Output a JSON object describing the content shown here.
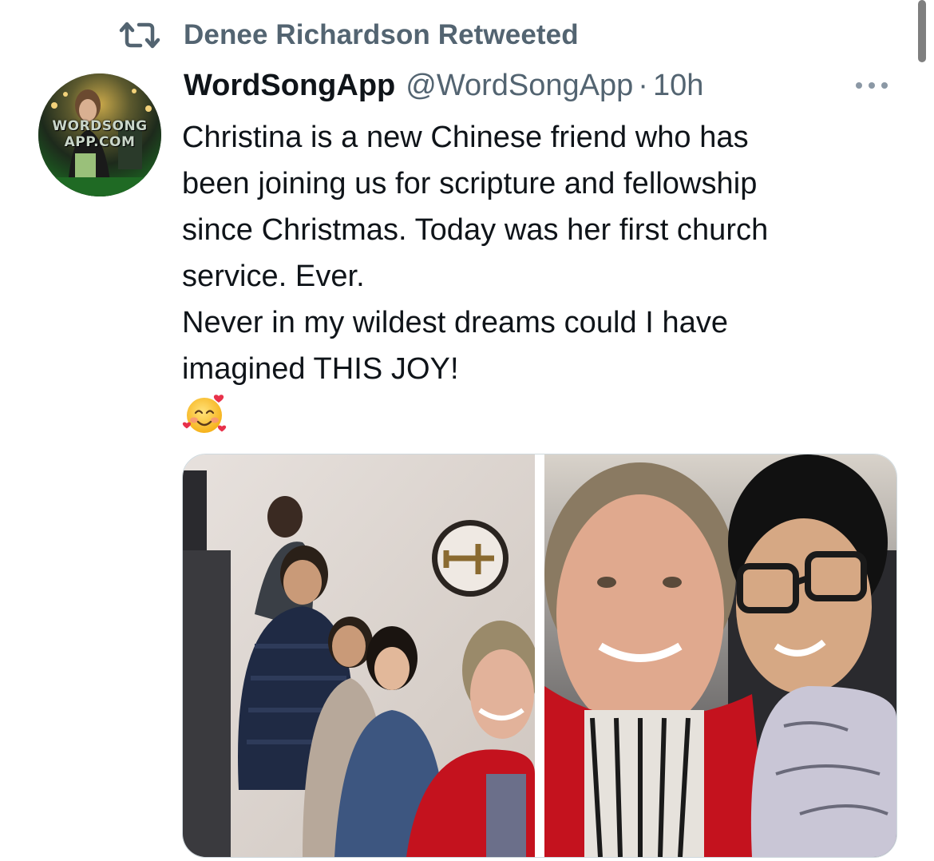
{
  "retweet": {
    "icon": "retweet-icon",
    "label": "Denee Richardson Retweeted"
  },
  "tweet": {
    "author": {
      "display_name": "WordSongApp",
      "handle": "@WordSongApp",
      "separator": "·",
      "time": "10h",
      "avatar_text_line1": "WORDSONG",
      "avatar_text_line2": "APP.COM"
    },
    "more_icon": "more-horizontal-icon",
    "text_lines": [
      "Christina is a new Chinese friend who has",
      "been joining us for scripture and fellowship",
      "since Christmas. Today was her first church",
      "service. Ever.",
      "Never in my wildest dreams could I have",
      "imagined THIS JOY!"
    ],
    "emoji": "smiling-face-with-hearts-emoji",
    "media": [
      {
        "kind": "photo",
        "subject": "group-selfie-in-church"
      },
      {
        "kind": "photo",
        "subject": "selfie-with-boy"
      }
    ]
  },
  "colors": {
    "text_primary": "#0f1419",
    "text_secondary": "#536471",
    "border": "#cfd9de"
  }
}
